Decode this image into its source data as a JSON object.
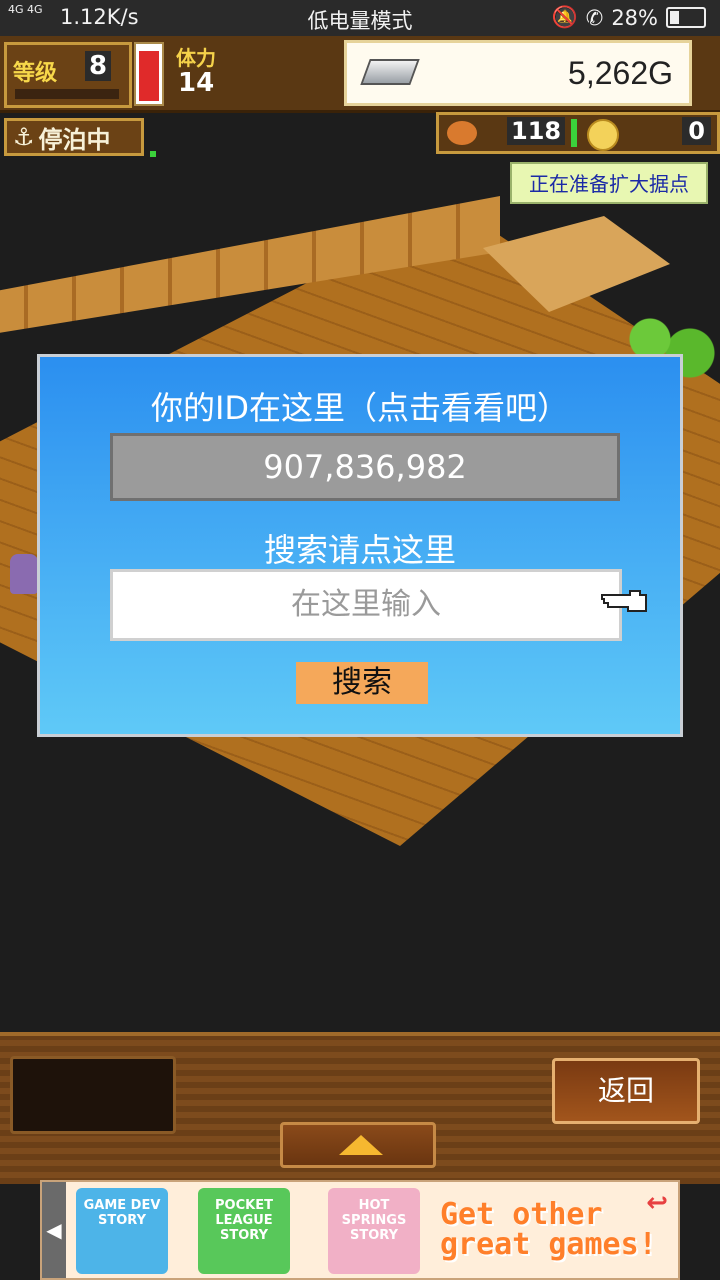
{
  "status_bar": {
    "network": "4G 4G",
    "speed": "1.12K/s",
    "mode": "低电量模式",
    "battery": "28%",
    "battery_level": 0.28
  },
  "hud": {
    "level_label": "等级",
    "level_value": "8",
    "stamina_label": "体力",
    "stamina_value": "14",
    "gold": "5,262G",
    "docked_label": "停泊中",
    "food_value": "118",
    "coin_value": "0",
    "notice": "正在准备扩大据点"
  },
  "dialog": {
    "title": "你的ID在这里（点击看看吧）",
    "id_value": "907,836,982",
    "search_title": "搜索请点这里",
    "search_placeholder": "在这里输入",
    "search_button": "搜索"
  },
  "bottom_panel": {
    "back_button": "返回"
  },
  "ad_banner": {
    "games": [
      "GAME DEV STORY",
      "POCKET LEAGUE STORY",
      "HOT SPRINGS STORY"
    ],
    "text_line1": "Get other",
    "text_line2": "great games!"
  }
}
